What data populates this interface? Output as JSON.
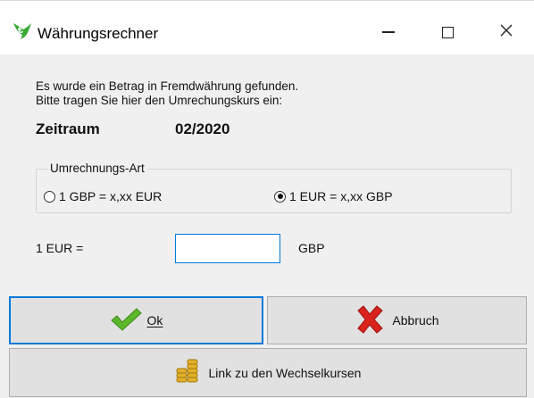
{
  "window": {
    "title": "Währungsrechner",
    "icon": "euro-currency-icon",
    "controls": [
      "minimize-icon",
      "maximize-icon",
      "close-icon"
    ]
  },
  "info": {
    "line1": "Es wurde ein Betrag in Fremdwährung gefunden.",
    "line2": "Bitte tragen Sie hier  den Umrechungskurs ein:"
  },
  "period": {
    "label": "Zeitraum",
    "value": "02/2020"
  },
  "conversion_type": {
    "legend": "Umrechnungs-Art",
    "option1": {
      "label": "1 GBP = x,xx EUR",
      "selected": false
    },
    "option2": {
      "label": "1 EUR = x,xx GBP",
      "selected": true
    }
  },
  "rate": {
    "label": "1 EUR =",
    "value": "",
    "unit": "GBP"
  },
  "buttons": {
    "ok": "Ok",
    "cancel": "Abbruch",
    "link": "Link zu den Wechselkursen"
  },
  "colors": {
    "accent": "#0078d7",
    "ok_check": "#5cb82a",
    "cancel_x": "#d9231c",
    "coins": "#d4a017"
  }
}
